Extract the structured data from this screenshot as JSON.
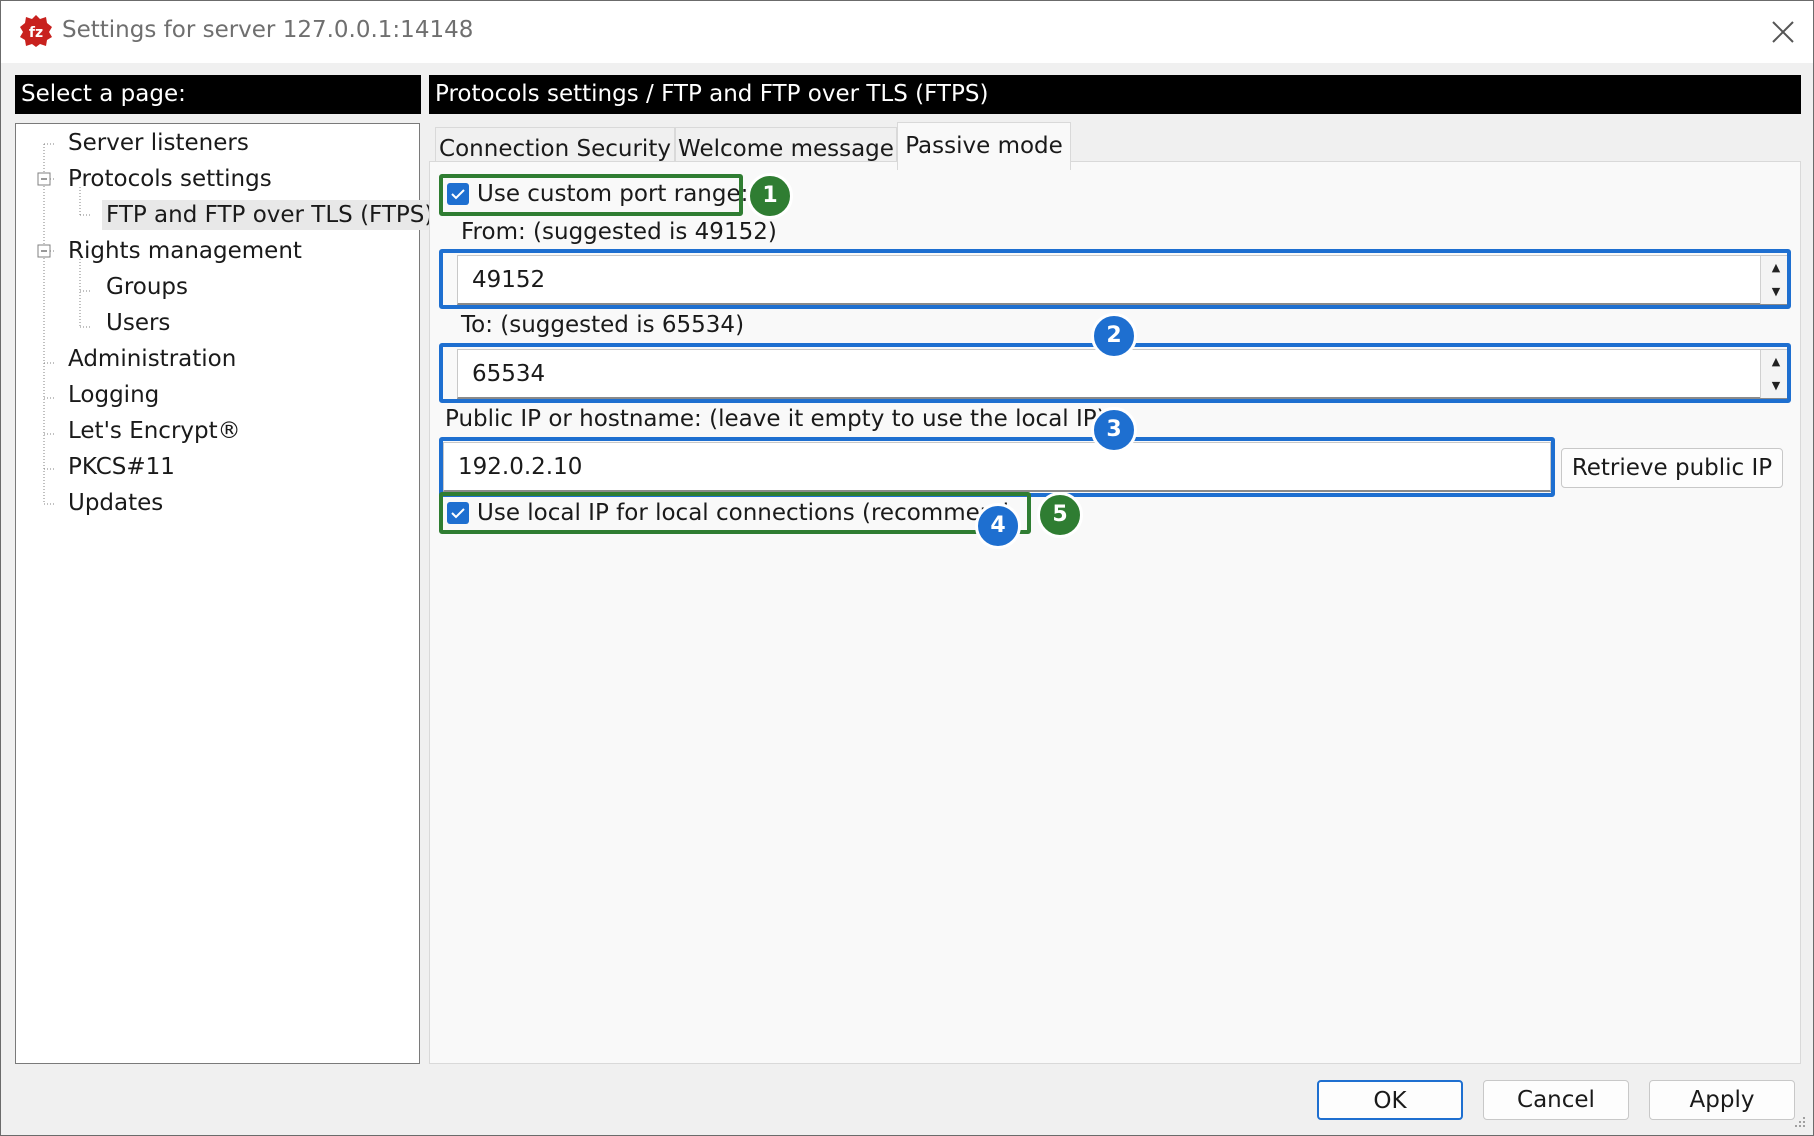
{
  "window": {
    "title": "Settings for server 127.0.0.1:14148"
  },
  "left_pane": {
    "header": "Select a page:",
    "tree": [
      {
        "label": "Server listeners"
      },
      {
        "label": "Protocols settings",
        "expanded": true
      },
      {
        "label": "FTP and FTP over TLS (FTPS)",
        "selected": true
      },
      {
        "label": "Rights management",
        "expanded": true
      },
      {
        "label": "Groups"
      },
      {
        "label": "Users"
      },
      {
        "label": "Administration"
      },
      {
        "label": "Logging"
      },
      {
        "label": "Let's Encrypt®"
      },
      {
        "label": "PKCS#11"
      },
      {
        "label": "Updates"
      }
    ]
  },
  "right_pane": {
    "header": "Protocols settings / FTP and FTP over TLS (FTPS)",
    "tabs": [
      {
        "label": "Connection Security"
      },
      {
        "label": "Welcome message"
      },
      {
        "label": "Passive mode",
        "active": true
      }
    ],
    "passive": {
      "custom_range_label": "Use custom port range:",
      "custom_range_checked": true,
      "from_label": "From: (suggested is 49152)",
      "from_value": "49152",
      "to_label": "To: (suggested is 65534)",
      "to_value": "65534",
      "public_ip_label": "Public IP or hostname: (leave it empty to use the local IP)",
      "public_ip_value": "192.0.2.10",
      "retrieve_button": "Retrieve public IP",
      "local_ip_label": "Use local IP for local connections (recommend",
      "local_ip_checked": true
    }
  },
  "footer": {
    "ok": "OK",
    "cancel": "Cancel",
    "apply": "Apply"
  },
  "annotations": {
    "badges": [
      "1",
      "2",
      "3",
      "4",
      "5"
    ],
    "colors": {
      "green": "#2f7d32",
      "blue": "#1e6fd0"
    }
  },
  "colors": {
    "accent": "#1e6fd0",
    "header_bg": "#000000",
    "app_icon": "#c8211e"
  }
}
